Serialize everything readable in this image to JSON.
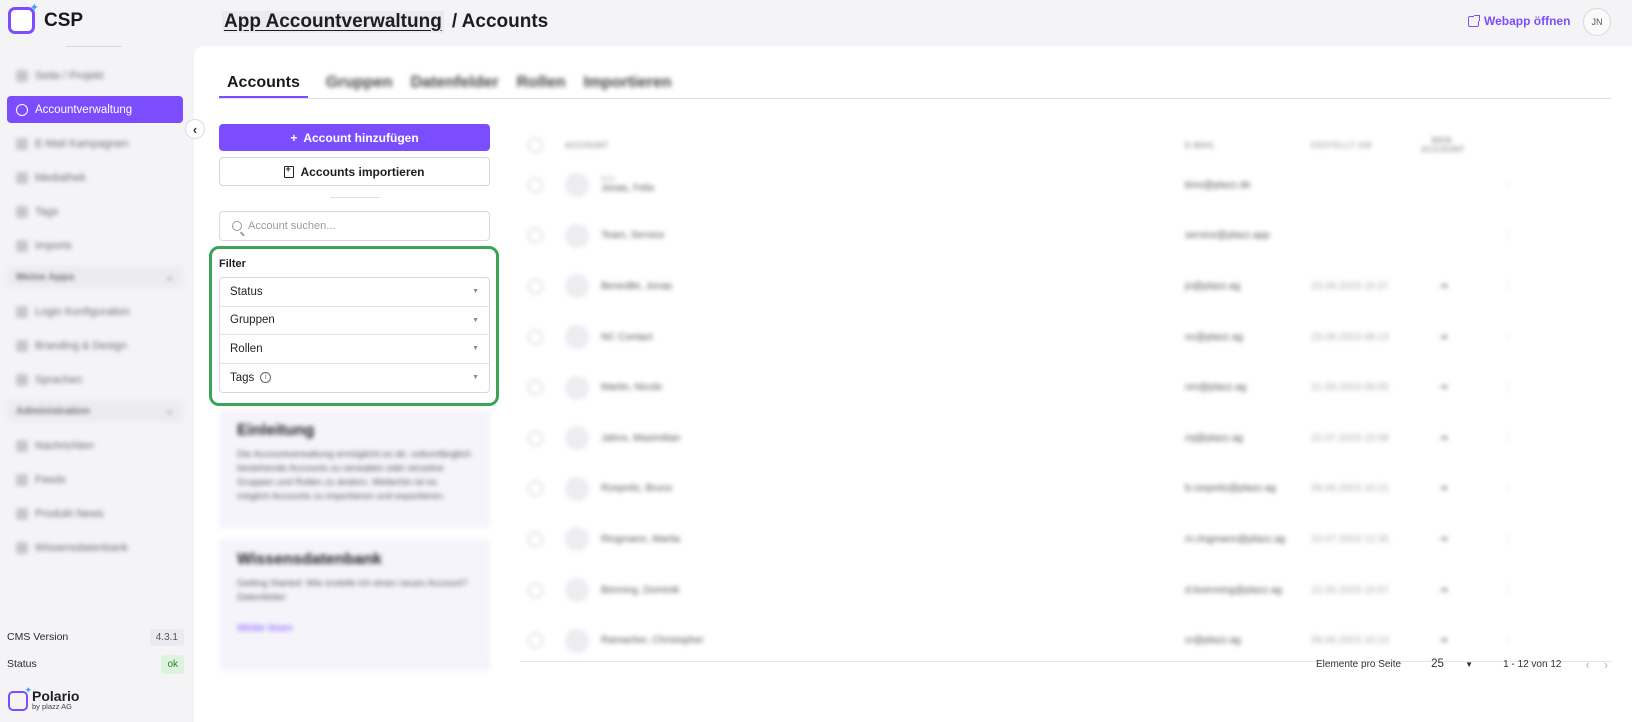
{
  "brand": {
    "name": "CSP"
  },
  "sidebar": {
    "items": [
      {
        "label": "Seite / Projekt",
        "active": false
      },
      {
        "label": "Accountverwaltung",
        "active": true
      },
      {
        "label": "E-Mail Kampagnen",
        "active": false
      },
      {
        "label": "Mediathek",
        "active": false
      },
      {
        "label": "Tags",
        "active": false
      },
      {
        "label": "Imports",
        "active": false
      }
    ],
    "section1": "Meine Apps",
    "items2": [
      {
        "label": "Login Konfiguration"
      },
      {
        "label": "Branding & Design"
      },
      {
        "label": "Sprachen"
      }
    ],
    "section2": "Administration",
    "items3": [
      {
        "label": "Nachrichten"
      },
      {
        "label": "Feeds"
      },
      {
        "label": "Produkt News"
      },
      {
        "label": "Wissensdatenbank"
      }
    ],
    "cms_label": "CMS Version",
    "cms_version": "4.3.1",
    "status_label": "Status",
    "status_value": "ok",
    "footer_brand": "Polario",
    "footer_sub": "by plazz AG"
  },
  "header": {
    "breadcrumb_parent": "App Accountverwaltung",
    "breadcrumb_current": "/ Accounts",
    "webapp_label": "Webapp öffnen",
    "avatar_initials": "JN"
  },
  "tabs": [
    "Accounts",
    "Gruppen",
    "Datenfelder",
    "Rollen",
    "Importieren"
  ],
  "actions": {
    "add_account": "Account hinzufügen",
    "import_accounts": "Accounts importieren",
    "search_placeholder": "Account suchen..."
  },
  "filter": {
    "title": "Filter",
    "options": [
      "Status",
      "Gruppen",
      "Rollen",
      "Tags"
    ]
  },
  "cards": [
    {
      "title": "Einleitung",
      "text": "Die Accountverwaltung ermöglicht es dir, vollumfänglich bestehende Accounts zu verwalten oder einzelne Gruppen und Rollen zu ändern. Weiterhin ist es möglich Accounts zu importieren und exportieren.",
      "link": ""
    },
    {
      "title": "Wissensdatenbank",
      "text": "Getting Started: Wie erstelle ich einen neuen Account? Datenfelder",
      "link": "Weiter lesen"
    }
  ],
  "table": {
    "headers": [
      "ACCOUNT",
      "E-MAIL",
      "ERSTELLT AM",
      "WEB-ACCOUNT",
      ""
    ],
    "rows": [
      {
        "sub": "Kino",
        "name": "Jonas, Felix",
        "email": "kino@plazz.de",
        "created": "",
        "web": "",
        "action": "⋮"
      },
      {
        "sub": "",
        "name": "Team, Service",
        "email": "service@plazz.app",
        "created": "",
        "web": "",
        "action": "⋮"
      },
      {
        "sub": "",
        "name": "Benedikt, Jonas",
        "email": "jn@plazz.ag",
        "created": "23.08.2023 10:37",
        "web": "⇥",
        "action": "⋮"
      },
      {
        "sub": "",
        "name": "NC Contact",
        "email": "nc@plazz.ag",
        "created": "23.08.2023 08:13",
        "web": "⇥",
        "action": "⋮"
      },
      {
        "sub": "",
        "name": "Martin, Nicole",
        "email": "nm@plazz.ag",
        "created": "21.08.2023 09:55",
        "web": "⇥",
        "action": "⋮"
      },
      {
        "sub": "",
        "name": "Jahns, Maximilian",
        "email": "mj@plazz.ag",
        "created": "22.07.2023 15:08",
        "web": "⇥",
        "action": "⋮"
      },
      {
        "sub": "",
        "name": "Rzepnitz, Bruno",
        "email": "b.rzepnitz@plazz.ag",
        "created": "09.06.2023 10:21",
        "web": "⇥",
        "action": "⋮"
      },
      {
        "sub": "",
        "name": "Ringmann, Marita",
        "email": "m.ringmann@plazz.ag",
        "created": "23.07.2023 12:35",
        "web": "⇥",
        "action": "⋮"
      },
      {
        "sub": "",
        "name": "Bönning, Dominik",
        "email": "d.boenning@plazz.ag",
        "created": "12.05.2023 10:57",
        "web": "⇥",
        "action": "⋮"
      },
      {
        "sub": "",
        "name": "Ramacher, Christopher",
        "email": "cr@plazz.ag",
        "created": "09.06.2023 10:13",
        "web": "⇥",
        "action": "⋮"
      }
    ]
  },
  "pagination": {
    "per_page_label": "Elemente pro Seite",
    "per_page_value": "25",
    "range": "1 - 12 von 12"
  },
  "colors": {
    "accent": "#7c4dff",
    "highlight": "#3aa655"
  }
}
